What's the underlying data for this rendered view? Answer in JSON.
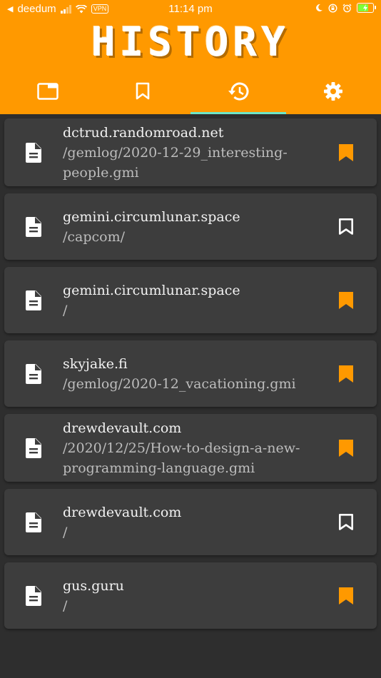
{
  "status": {
    "carrier": "deedum",
    "vpn": "VPN",
    "time": "11:14 pm"
  },
  "header": {
    "title": "HISTORY",
    "tabs": [
      {
        "icon": "tabs-icon",
        "active": false
      },
      {
        "icon": "bookmark-icon",
        "active": false
      },
      {
        "icon": "history-icon",
        "active": true
      },
      {
        "icon": "settings-gear-icon",
        "active": false
      }
    ]
  },
  "colors": {
    "accent": "#ff9900",
    "active_tab_indicator": "#6ee7c8",
    "bookmark_filled": "#ff9900",
    "card": "#3d3d3d",
    "background": "#2e2e2e"
  },
  "history": [
    {
      "host": "dctrud.randomroad.net",
      "path_lines": [
        "/gemlog/2020-12-29_interesting-",
        "people.gmi"
      ],
      "bookmarked": true
    },
    {
      "host": "gemini.circumlunar.space",
      "path_lines": [
        "/capcom/"
      ],
      "bookmarked": false
    },
    {
      "host": "gemini.circumlunar.space",
      "path_lines": [
        "/"
      ],
      "bookmarked": true
    },
    {
      "host": "skyjake.fi",
      "path_lines": [
        "/gemlog/2020-12_vacationing.gmi"
      ],
      "bookmarked": true
    },
    {
      "host": "drewdevault.com",
      "path_lines": [
        "/2020/12/25/How-to-design-a-new-",
        "programming-language.gmi"
      ],
      "bookmarked": true
    },
    {
      "host": "drewdevault.com",
      "path_lines": [
        "/"
      ],
      "bookmarked": false
    },
    {
      "host": "gus.guru",
      "path_lines": [
        "/"
      ],
      "bookmarked": true
    }
  ]
}
